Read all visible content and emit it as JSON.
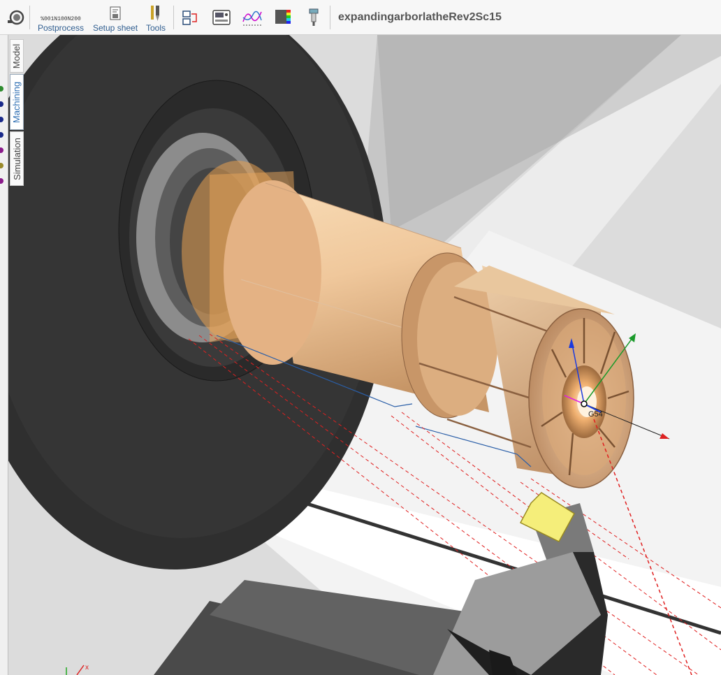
{
  "toolbar": {
    "postprocess_label": "Postprocess",
    "postprocess_icon_text": [
      "%001",
      "N100",
      "N200"
    ],
    "setup_sheet_label": "Setup sheet",
    "tools_label": "Tools",
    "document_title": "expandingarborlatheRev2Sc15"
  },
  "side_tabs": {
    "model": "Model",
    "machining": "Machining",
    "simulation": "Simulation"
  },
  "operation_dots": [
    "#2e8b2e",
    "#1a2a8a",
    "#1a2a8a",
    "#1a2a8a",
    "#8a1a8a",
    "#9a8a2a",
    "#8a1a8a"
  ],
  "viewport": {
    "wcs_label": "G54"
  }
}
